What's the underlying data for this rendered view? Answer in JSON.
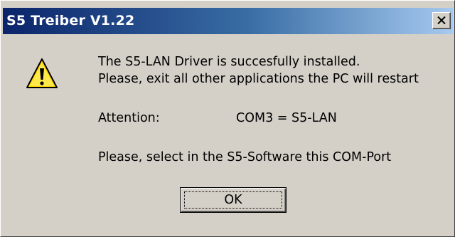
{
  "window": {
    "title": "S5 Treiber V1.22",
    "close_icon": "close-icon"
  },
  "message": {
    "icon": "warning-icon",
    "line1": "The S5-LAN Driver is succesfully installed.",
    "line2": "Please, exit all other applications the PC will restart",
    "attention_label": "Attention:",
    "attention_value": "COM3 = S5-LAN",
    "line4": "Please, select in the S5-Software this COM-Port"
  },
  "buttons": {
    "ok_label": "OK"
  },
  "colors": {
    "titlebar_start": "#0a246a",
    "titlebar_end": "#a6caf0",
    "dialog_face": "#d4d0c8",
    "warning_yellow": "#ffd800"
  }
}
